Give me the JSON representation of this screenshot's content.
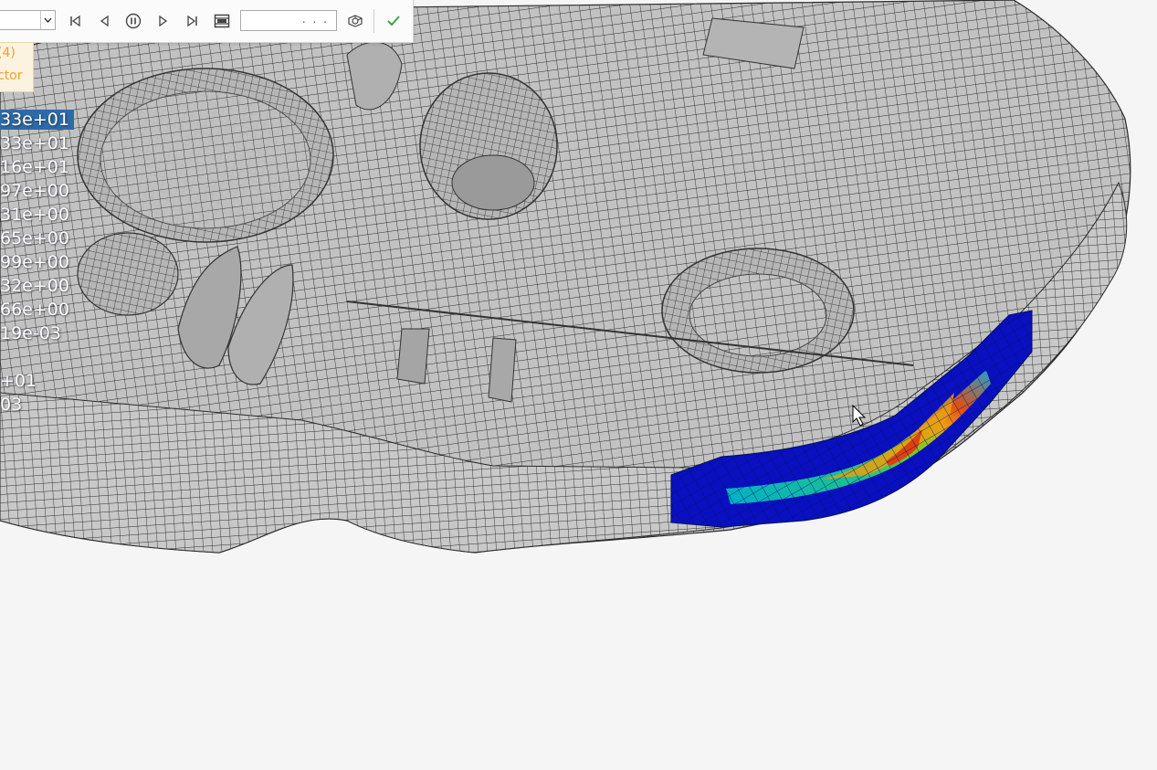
{
  "toolbar": {
    "frame_value": "",
    "time_value": ". . .",
    "buttons": {
      "first": "skip-to-first-icon",
      "prev": "step-back-icon",
      "pause": "pause-icon",
      "next": "step-forward-icon",
      "last": "skip-to-last-icon",
      "record": "film-record-icon",
      "settings": "animation-settings-icon",
      "apply": "checkmark-icon"
    }
  },
  "legend": {
    "line1": "(4)",
    "line2": "ctor"
  },
  "contour_values": [
    "33e+01",
    "33e+01",
    "16e+01",
    "97e+00",
    "31e+00",
    "65e+00",
    "99e+00",
    "32e+00",
    "66e+00",
    "19e-03"
  ],
  "minmax": {
    "max": "+01",
    "min": "03"
  },
  "colors": {
    "mesh_fill": "#bdbdbd",
    "mesh_line": "#2a2a2a",
    "background": "#f5f5f5",
    "legend_text": "#f0a030",
    "selected_value_bg": "#2d6aa8",
    "contour_low": "#0010b0",
    "contour_mid": "#00a0c8",
    "contour_high": "#f03010"
  }
}
